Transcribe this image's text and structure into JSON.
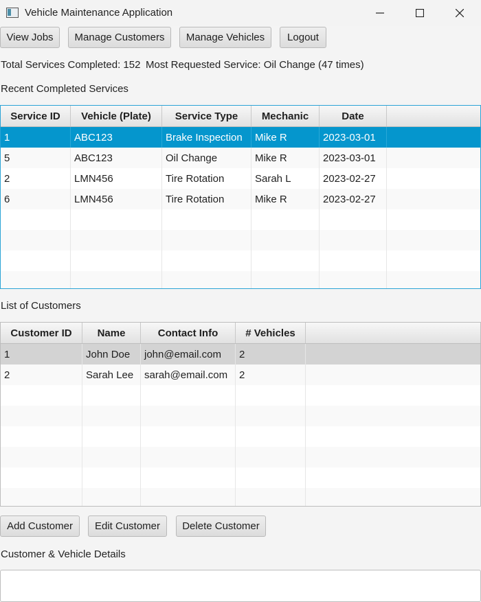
{
  "window": {
    "title": "Vehicle Maintenance Application",
    "app_icon": "app-window-icon",
    "controls": [
      "minimize-icon",
      "maximize-icon",
      "close-icon"
    ]
  },
  "nav": {
    "view_jobs": "View Jobs",
    "manage_customers": "Manage Customers",
    "manage_vehicles": "Manage Vehicles",
    "logout": "Logout"
  },
  "stats": {
    "total_services": "Total Services Completed: 152",
    "most_requested": "Most Requested Service: Oil Change (47 times)"
  },
  "services": {
    "section_label": "Recent Completed Services",
    "columns": [
      "Service ID",
      "Vehicle (Plate)",
      "Service Type",
      "Mechanic",
      "Date"
    ],
    "rows": [
      [
        "1",
        "ABC123",
        "Brake Inspection",
        "Mike R",
        "2023-03-01"
      ],
      [
        "5",
        "ABC123",
        "Oil Change",
        "Mike R",
        "2023-03-01"
      ],
      [
        "2",
        "LMN456",
        "Tire Rotation",
        "Sarah L",
        "2023-02-27"
      ],
      [
        "6",
        "LMN456",
        "Tire Rotation",
        "Mike R",
        "2023-02-27"
      ]
    ],
    "selected_row": 0,
    "selection_color": "#0596cd"
  },
  "customers": {
    "section_label": "List of Customers",
    "columns": [
      "Customer ID",
      "Name",
      "Contact Info",
      "# Vehicles"
    ],
    "rows": [
      [
        "1",
        "John Doe",
        "john@email.com",
        "2"
      ],
      [
        "2",
        "Sarah Lee",
        "sarah@email.com",
        "2"
      ]
    ],
    "selected_row": 0
  },
  "actions": {
    "add": "Add Customer",
    "edit": "Edit Customer",
    "delete": "Delete Customer"
  },
  "details": {
    "section_label": "Customer & Vehicle Details",
    "value": ""
  }
}
